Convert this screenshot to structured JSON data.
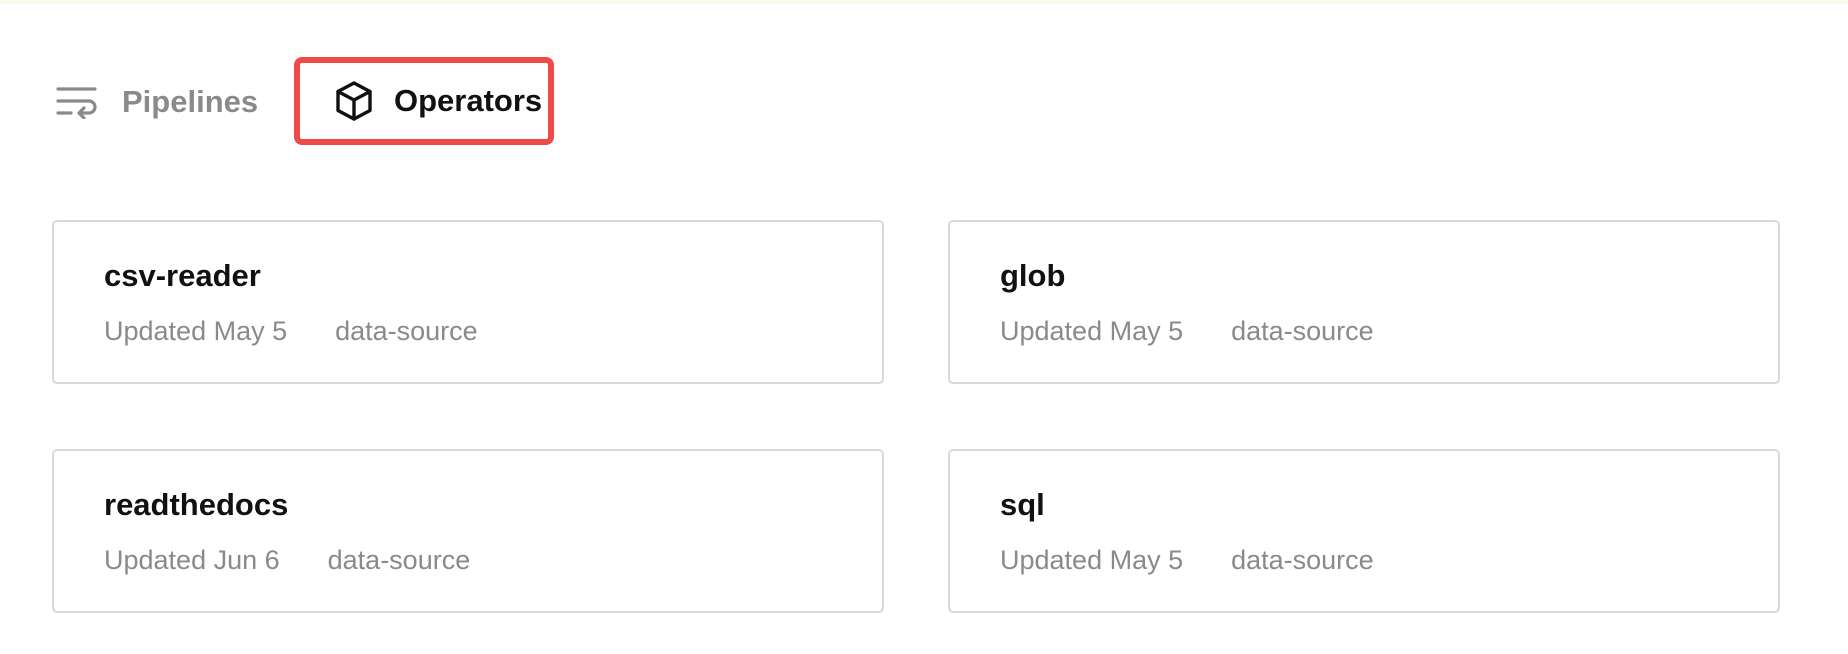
{
  "tabs": {
    "pipelines": {
      "label": "Pipelines",
      "icon": "wrap-lines-icon",
      "active": false
    },
    "operators": {
      "label": "Operators",
      "icon": "cube-icon",
      "active": true
    }
  },
  "highlight_color": "#ef4a46",
  "operators": [
    {
      "name": "csv-reader",
      "updated": "Updated May 5",
      "tag": "data-source"
    },
    {
      "name": "glob",
      "updated": "Updated May 5",
      "tag": "data-source"
    },
    {
      "name": "readthedocs",
      "updated": "Updated Jun 6",
      "tag": "data-source"
    },
    {
      "name": "sql",
      "updated": "Updated May 5",
      "tag": "data-source"
    }
  ]
}
